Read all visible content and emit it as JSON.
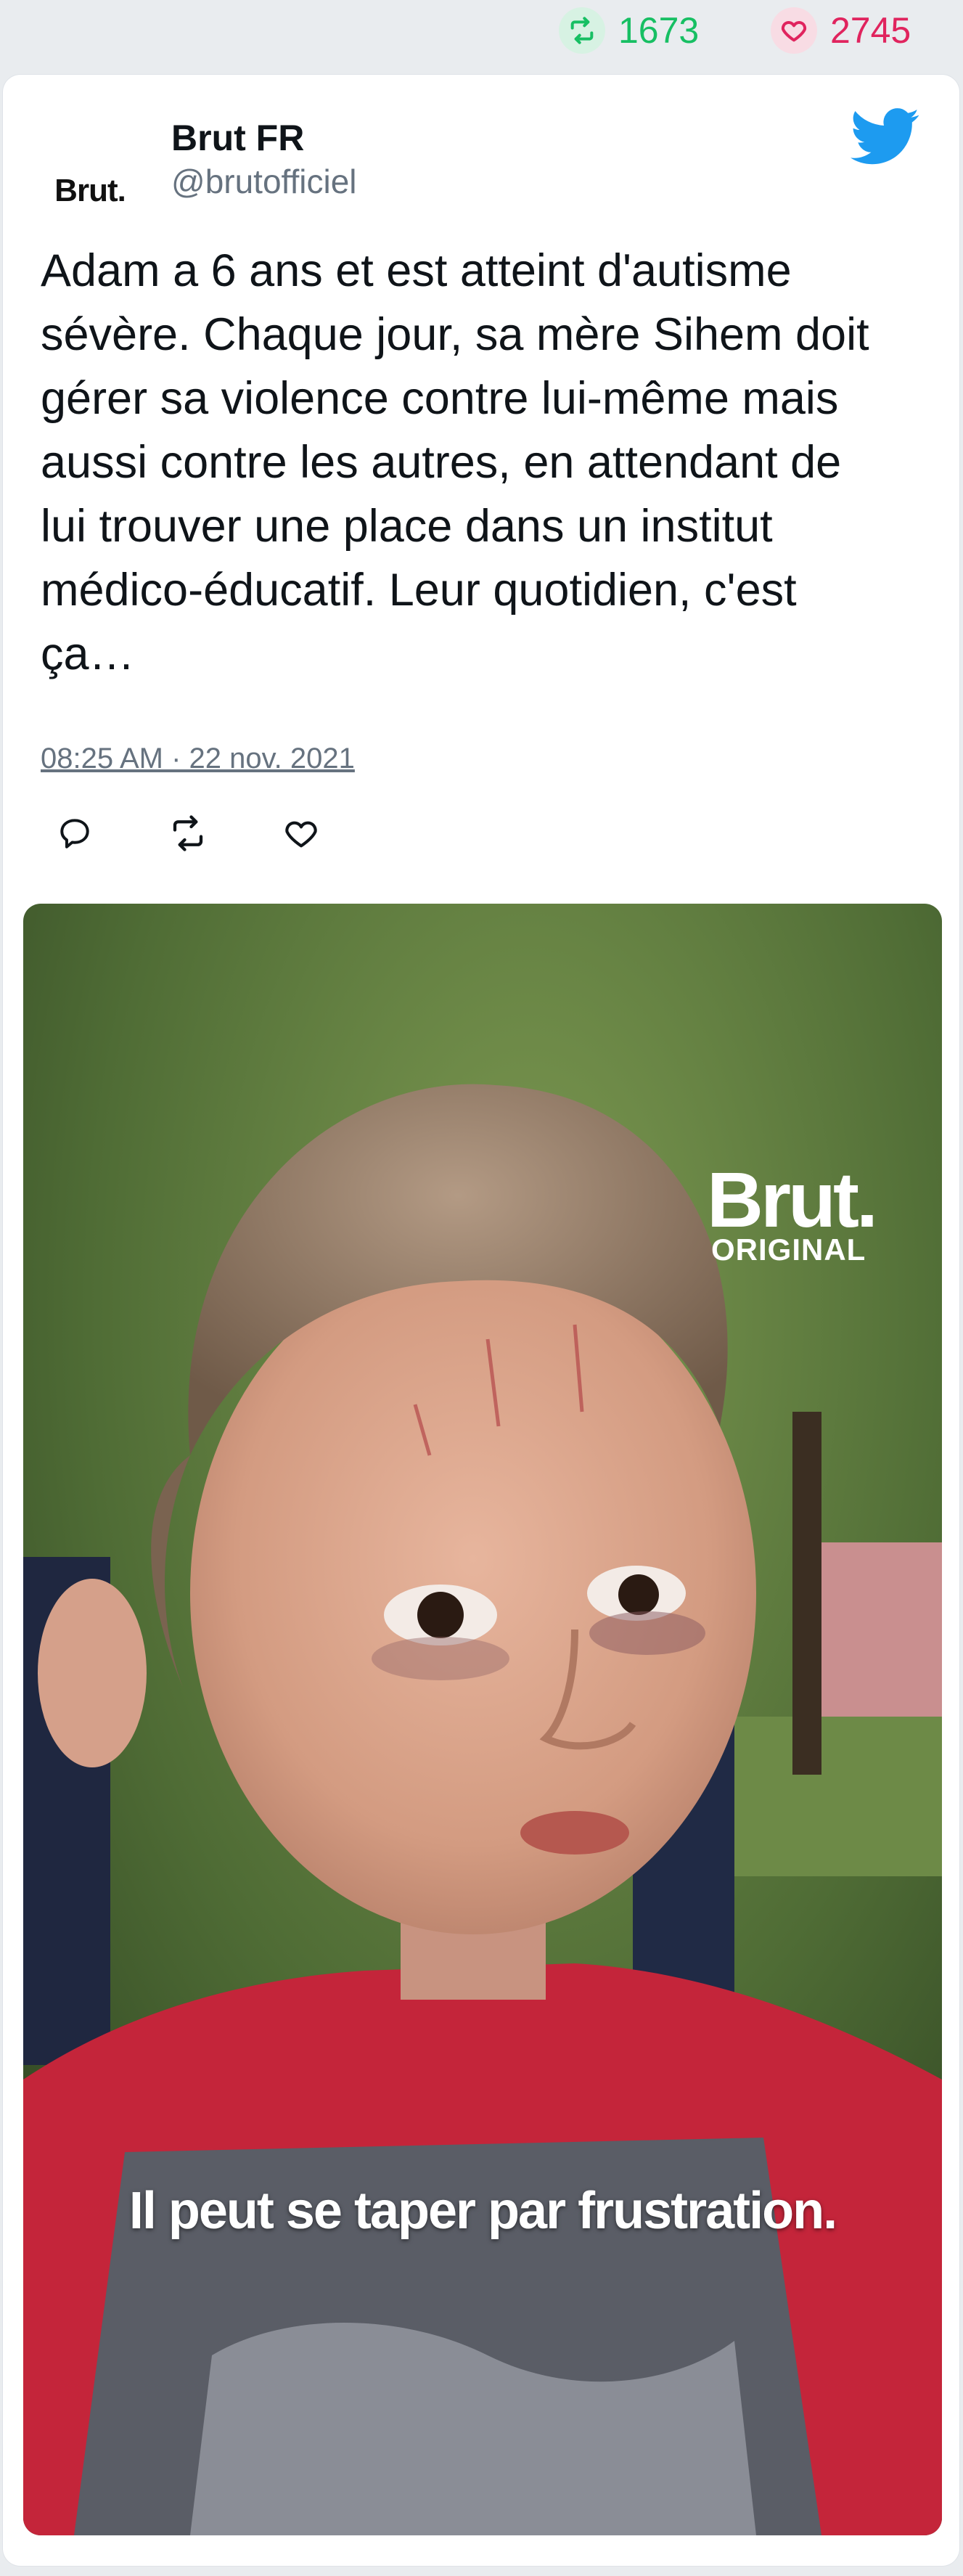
{
  "stats": {
    "retweets": "1673",
    "likes": "2745"
  },
  "author": {
    "name": "Brut FR",
    "handle": "@brutofficiel",
    "logo_text": "Brut."
  },
  "tweet": {
    "text": "Adam a 6 ans et est atteint d'autisme\nsévère. Chaque jour, sa mère Sihem doit\ngérer sa violence contre lui-même mais\naussi contre les autres, en attendant de\nlui trouver une place dans un institut\nmédico-éducatif. Leur quotidien, c'est\nça…",
    "timestamp": "08:25 AM · 22 nov. 2021"
  },
  "media": {
    "watermark_brand": "Brut.",
    "watermark_label": "ORIGINAL",
    "caption": "Il peut se taper par frustration."
  },
  "icons": {
    "retweet": "retweet-icon",
    "like": "heart-icon",
    "reply": "reply-icon",
    "platform": "twitter-bird-icon"
  },
  "colors": {
    "retweet": "#17bf63",
    "like": "#e0245e",
    "twitter_blue": "#1d9bf0",
    "text": "#0f1419",
    "muted": "#66727f"
  }
}
